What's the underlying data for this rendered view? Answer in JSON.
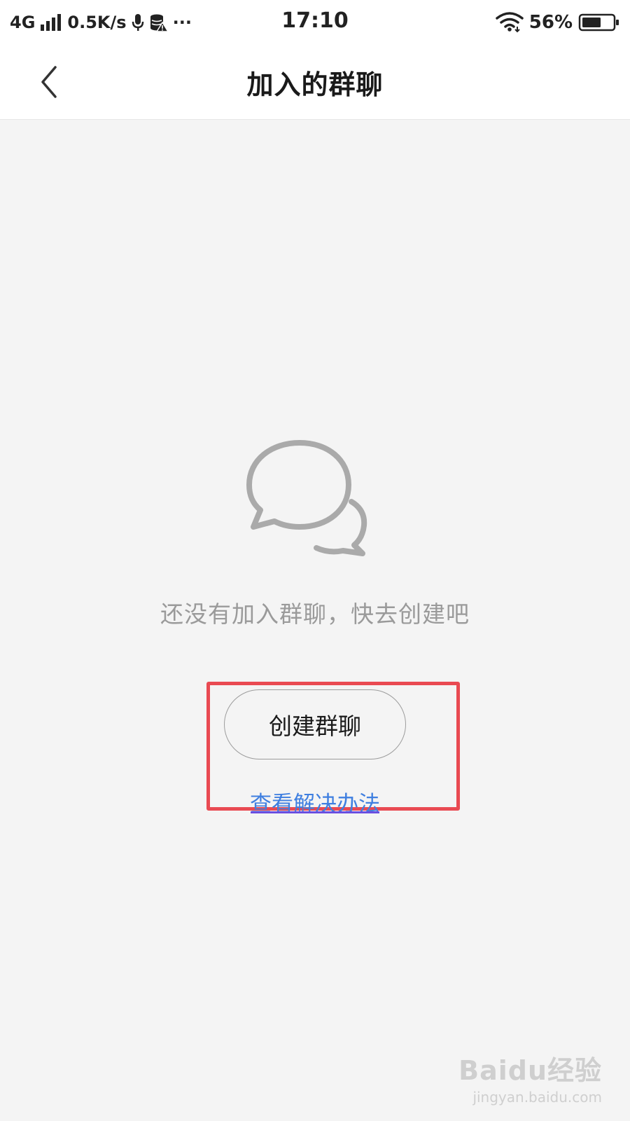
{
  "status_bar": {
    "network": "4G",
    "speed": "0.5K/s",
    "more": "···",
    "time": "17:10",
    "battery": "56%"
  },
  "header": {
    "title": "加入的群聊"
  },
  "empty_state": {
    "message": "还没有加入群聊，快去创建吧",
    "create_button": "创建群聊",
    "help_link": "查看解决办法"
  },
  "watermark": {
    "logo": "Baidu经验",
    "url": "jingyan.baidu.com"
  },
  "colors": {
    "accent_link": "#3f7fe0",
    "highlight_box": "#e94a52",
    "background": "#f4f4f4"
  }
}
